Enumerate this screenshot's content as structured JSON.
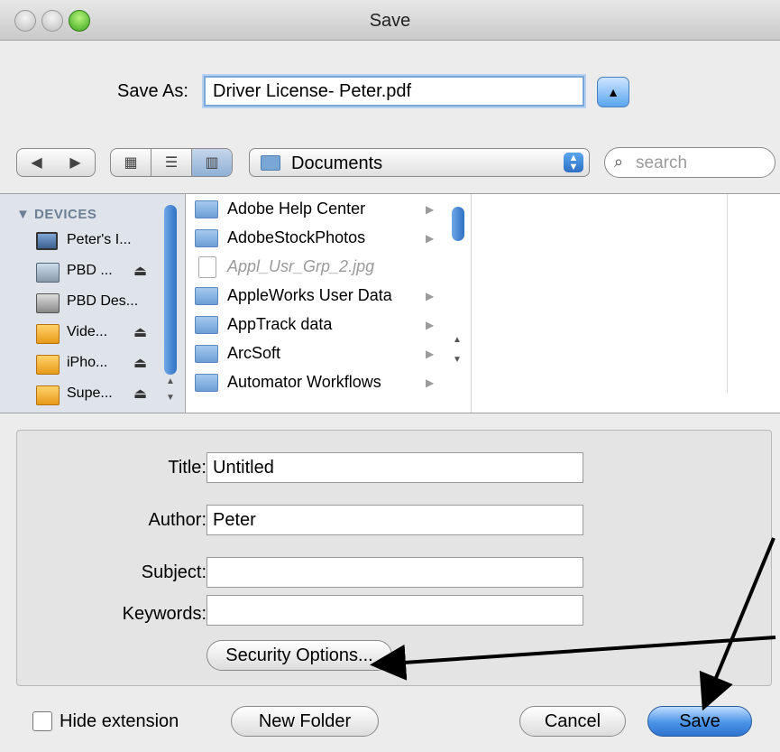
{
  "window": {
    "title": "Save"
  },
  "save_as": {
    "label": "Save As:",
    "value": "Driver License- Peter.pdf"
  },
  "location": {
    "selected": "Documents"
  },
  "search": {
    "placeholder": "search"
  },
  "sidebar": {
    "section": "DEVICES",
    "items": [
      {
        "label": "Peter's I...",
        "icon": "computer-icon",
        "eject": false
      },
      {
        "label": "PBD ...",
        "icon": "disk-icon",
        "eject": true
      },
      {
        "label": "PBD Des...",
        "icon": "hard-drive-icon",
        "eject": false
      },
      {
        "label": "Vide...",
        "icon": "volume-icon",
        "eject": true
      },
      {
        "label": "iPho...",
        "icon": "volume-icon",
        "eject": true
      },
      {
        "label": "Supe...",
        "icon": "volume-icon",
        "eject": true
      }
    ]
  },
  "files": [
    {
      "label": "Adobe Help Center",
      "type": "folder"
    },
    {
      "label": "AdobeStockPhotos",
      "type": "folder"
    },
    {
      "label": "Appl_Usr_Grp_2.jpg",
      "type": "file"
    },
    {
      "label": "AppleWorks User Data",
      "type": "folder"
    },
    {
      "label": "AppTrack data",
      "type": "folder"
    },
    {
      "label": "ArcSoft",
      "type": "folder"
    },
    {
      "label": "Automator Workflows",
      "type": "folder"
    }
  ],
  "metadata": {
    "title_label": "Title:",
    "title_value": "Untitled",
    "author_label": "Author:",
    "author_value": "Peter",
    "subject_label": "Subject:",
    "subject_value": "",
    "keywords_label": "Keywords:",
    "keywords_value": ""
  },
  "buttons": {
    "security": "Security Options...",
    "hide_extension": "Hide extension",
    "new_folder": "New Folder",
    "cancel": "Cancel",
    "save": "Save"
  }
}
